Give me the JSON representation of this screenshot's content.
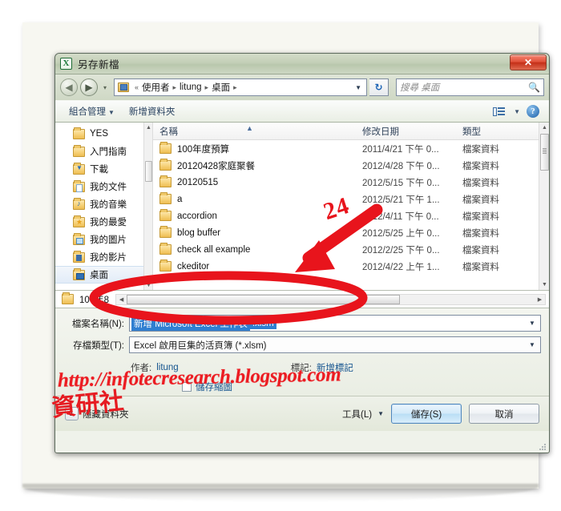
{
  "window": {
    "title": "另存新檔",
    "app_icon": "excel-icon",
    "close_label": "✕"
  },
  "nav": {
    "back_icon": "back-arrow-icon",
    "forward_icon": "forward-arrow-icon",
    "history_caret": "▾",
    "breadcrumb_prefix": "«",
    "breadcrumb": [
      "使用者",
      "litung",
      "桌面"
    ],
    "separator": "▸",
    "address_caret": "▼",
    "refresh_icon": "↻",
    "search_placeholder": "搜尋 桌面",
    "search_icon": "search-icon"
  },
  "command_bar": {
    "organize": "組合管理",
    "organize_caret": "▼",
    "new_folder": "新增資料夾",
    "view_icon": "list-view-icon",
    "view_caret": "▼",
    "help_icon": "?"
  },
  "tree": {
    "items": [
      {
        "label": "YES",
        "icon": "folder-icon"
      },
      {
        "label": "入門指南",
        "icon": "folder-icon"
      },
      {
        "label": "下載",
        "icon": "folder-download-icon"
      },
      {
        "label": "我的文件",
        "icon": "folder-documents-icon"
      },
      {
        "label": "我的音樂",
        "icon": "folder-music-icon"
      },
      {
        "label": "我的最愛",
        "icon": "folder-favorites-icon"
      },
      {
        "label": "我的圖片",
        "icon": "folder-pictures-icon"
      },
      {
        "label": "我的影片",
        "icon": "folder-videos-icon"
      },
      {
        "label": "桌面",
        "icon": "folder-desktop-icon",
        "selected": true
      }
    ],
    "scroll_up": "▲",
    "scroll_down": "▼"
  },
  "file_list": {
    "columns": [
      "名稱",
      "修改日期",
      "類型"
    ],
    "sort_indicator": "▲",
    "rows": [
      {
        "name": "100年度預算",
        "date": "2011/4/21 下午 0...",
        "type": "檔案資料"
      },
      {
        "name": "20120428家庭聚餐",
        "date": "2012/4/28 下午 0...",
        "type": "檔案資料"
      },
      {
        "name": "20120515",
        "date": "2012/5/15 下午 0...",
        "type": "檔案資料"
      },
      {
        "name": "a",
        "date": "2012/5/21 下午 1...",
        "type": "檔案資料"
      },
      {
        "name": "accordion",
        "date": "2012/4/11 下午 0...",
        "type": "檔案資料"
      },
      {
        "name": "blog buffer",
        "date": "2012/5/25 上午 0...",
        "type": "檔案資料"
      },
      {
        "name": "check all example",
        "date": "2012/2/25 下午 0...",
        "type": "檔案資料"
      },
      {
        "name": "ckeditor",
        "date": "2012/4/22 上午 1...",
        "type": "檔案資料"
      }
    ],
    "partial_row": "100年8",
    "scroll_up": "▲",
    "scroll_down": "▼",
    "hscroll_left": "◀",
    "hscroll_right": "▶"
  },
  "form": {
    "filename_label": "檔案名稱(N):",
    "filename_value": "新增 Microsoft Excel 工作表",
    "filename_ext": ".xlsm",
    "filetype_label": "存檔類型(T):",
    "filetype_value": "Excel 啟用巨集的活頁簿 (*.xlsm)",
    "dropdown_caret": "▼",
    "author_label": "作者:",
    "author_value": "litung",
    "tags_label": "標記:",
    "tags_value": "新增標記",
    "thumbnail_label": "儲存縮圖"
  },
  "footer": {
    "hide_folders_label": "隱藏資料夾",
    "hide_folders_caret": "▲",
    "tools_label": "工具(L)",
    "tools_caret": "▼",
    "save_label": "儲存(S)",
    "cancel_label": "取消"
  },
  "annotations": {
    "step_number": "24",
    "arrow_color": "#e8141c"
  },
  "watermark": {
    "url": "http://infotecresearch.blogspot.com",
    "site_name": "資研社",
    "color": "#ec1c22"
  }
}
